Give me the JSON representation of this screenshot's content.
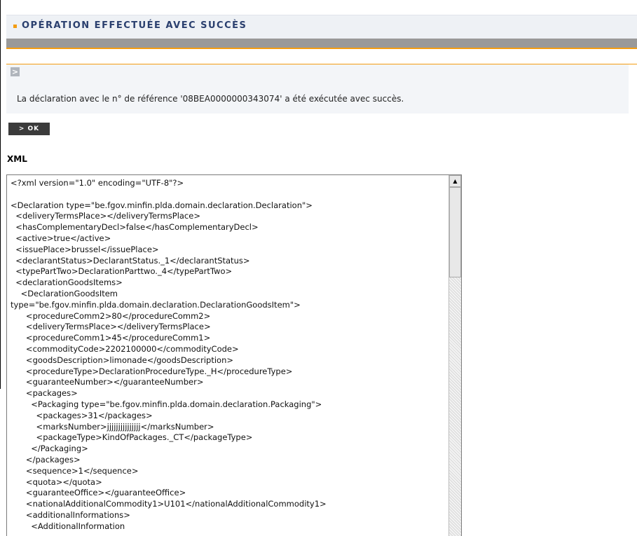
{
  "header": {
    "title": "OPÉRATION EFFECTUÉE AVEC SUCCÈS"
  },
  "message": {
    "arrow": ">",
    "text": "La déclaration avec le n° de référence '08BEA0000000343074' a été exécutée avec succès."
  },
  "actions": {
    "ok_label": "> OK"
  },
  "xml": {
    "label": "XML",
    "content": "<?xml version=\"1.0\" encoding=\"UTF-8\"?>\n\n<Declaration type=\"be.fgov.minfin.plda.domain.declaration.Declaration\">\n  <deliveryTermsPlace></deliveryTermsPlace>\n  <hasComplementaryDecl>false</hasComplementaryDecl>\n  <active>true</active>\n  <issuePlace>brussel</issuePlace>\n  <declarantStatus>DeclarantStatus._1</declarantStatus>\n  <typePartTwo>DeclarationParttwo._4</typePartTwo>\n  <declarationGoodsItems>\n    <DeclarationGoodsItem\ntype=\"be.fgov.minfin.plda.domain.declaration.DeclarationGoodsItem\">\n      <procedureComm2>80</procedureComm2>\n      <deliveryTermsPlace></deliveryTermsPlace>\n      <procedureComm1>45</procedureComm1>\n      <commodityCode>2202100000</commodityCode>\n      <goodsDescription>limonade</goodsDescription>\n      <procedureType>DeclarationProcedureType._H</procedureType>\n      <guaranteeNumber></guaranteeNumber>\n      <packages>\n        <Packaging type=\"be.fgov.minfin.plda.domain.declaration.Packaging\">\n          <packages>31</packages>\n          <marksNumber>jjjjjjjjjjjjjjj</marksNumber>\n          <packageType>KindOfPackages._CT</packageType>\n        </Packaging>\n      </packages>\n      <sequence>1</sequence>\n      <quota></quota>\n      <guaranteeOffice></guaranteeOffice>\n      <nationalAdditionalCommodity1>U101</nationalAdditionalCommodity1>\n      <additionalInformations>\n        <AdditionalInformation"
  }
}
